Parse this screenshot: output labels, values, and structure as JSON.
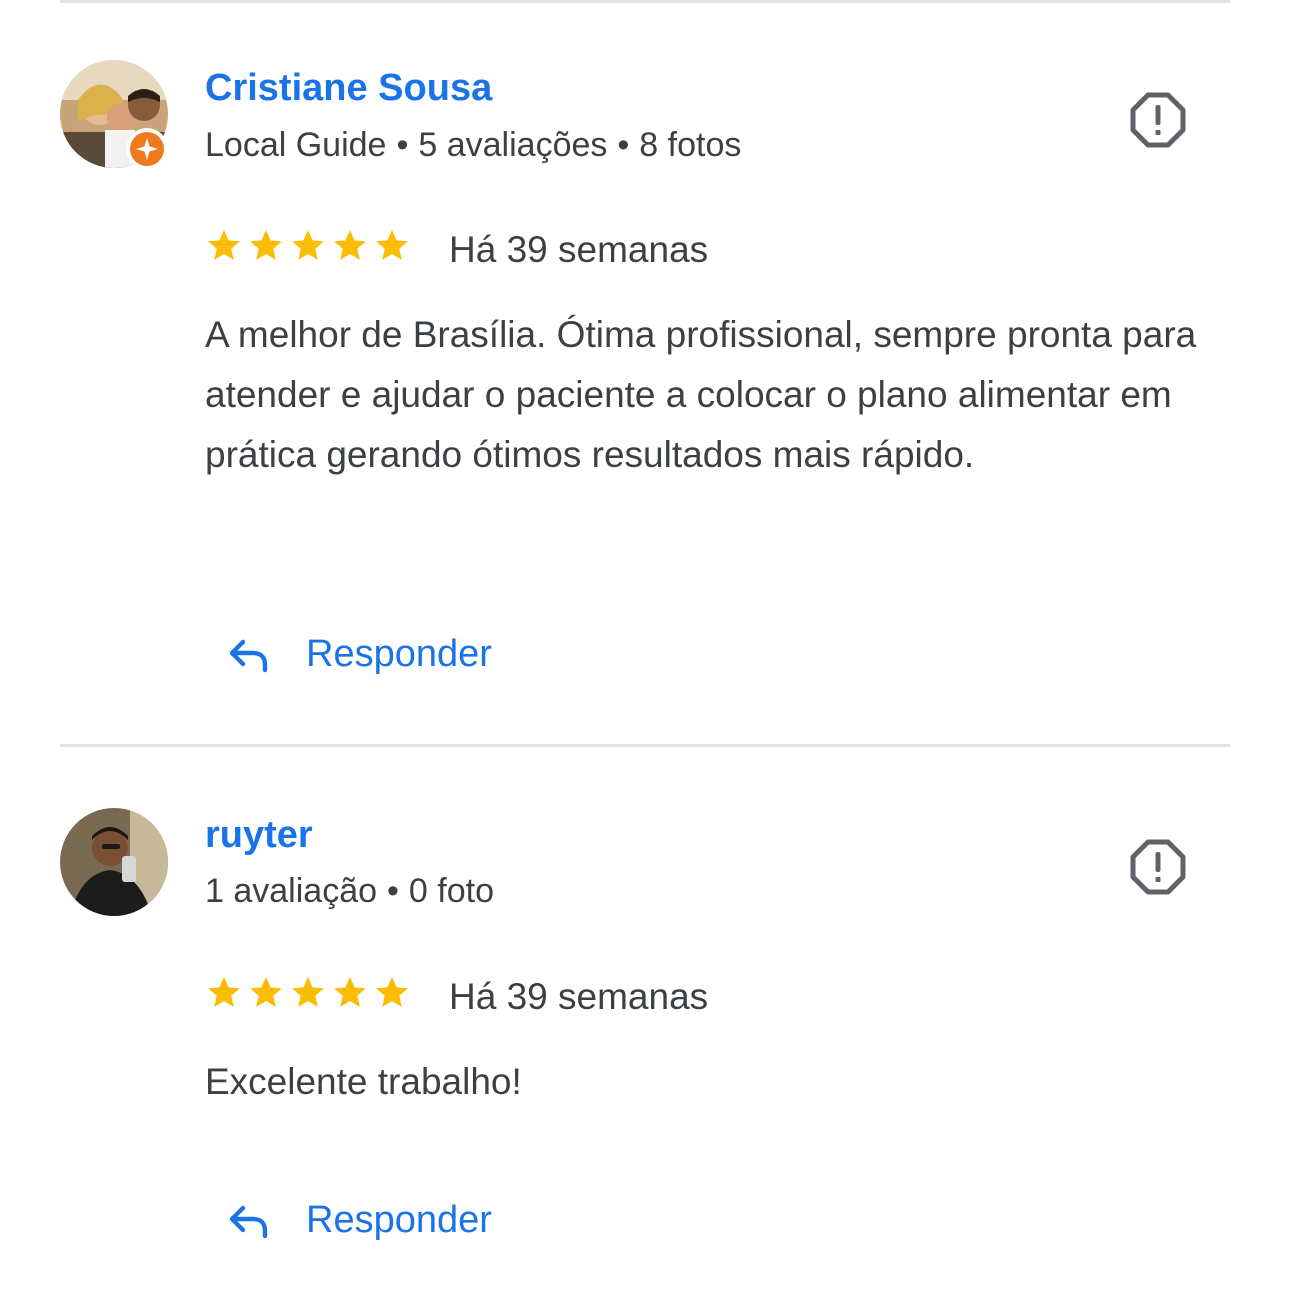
{
  "colors": {
    "accent": "#1a73e8",
    "text": "#3c4043",
    "star": "#fbbc04",
    "divider": "#e0e0e0",
    "local_guide_badge": "#ee7a1f",
    "report_icon": "#5f6368"
  },
  "reviews": [
    {
      "author": "Cristiane Sousa",
      "meta_parts": [
        "Local Guide",
        "5 avaliações",
        "8 fotos"
      ],
      "is_local_guide": true,
      "rating": 5,
      "time": "Há 39 semanas",
      "text": "A melhor de Brasília. Ótima profissional, sempre pronta para atender e ajudar o paciente a colocar o plano alimentar em prática gerando ótimos resultados mais rápido.",
      "reply_label": "Responder",
      "avatar_icon": "user-photo",
      "report_icon": "report-icon"
    },
    {
      "author": "ruyter",
      "meta_parts": [
        "1 avaliação",
        "0 foto"
      ],
      "is_local_guide": false,
      "rating": 5,
      "time": "Há 39 semanas",
      "text": "Excelente trabalho!",
      "reply_label": "Responder",
      "avatar_icon": "user-photo",
      "report_icon": "report-icon"
    }
  ]
}
